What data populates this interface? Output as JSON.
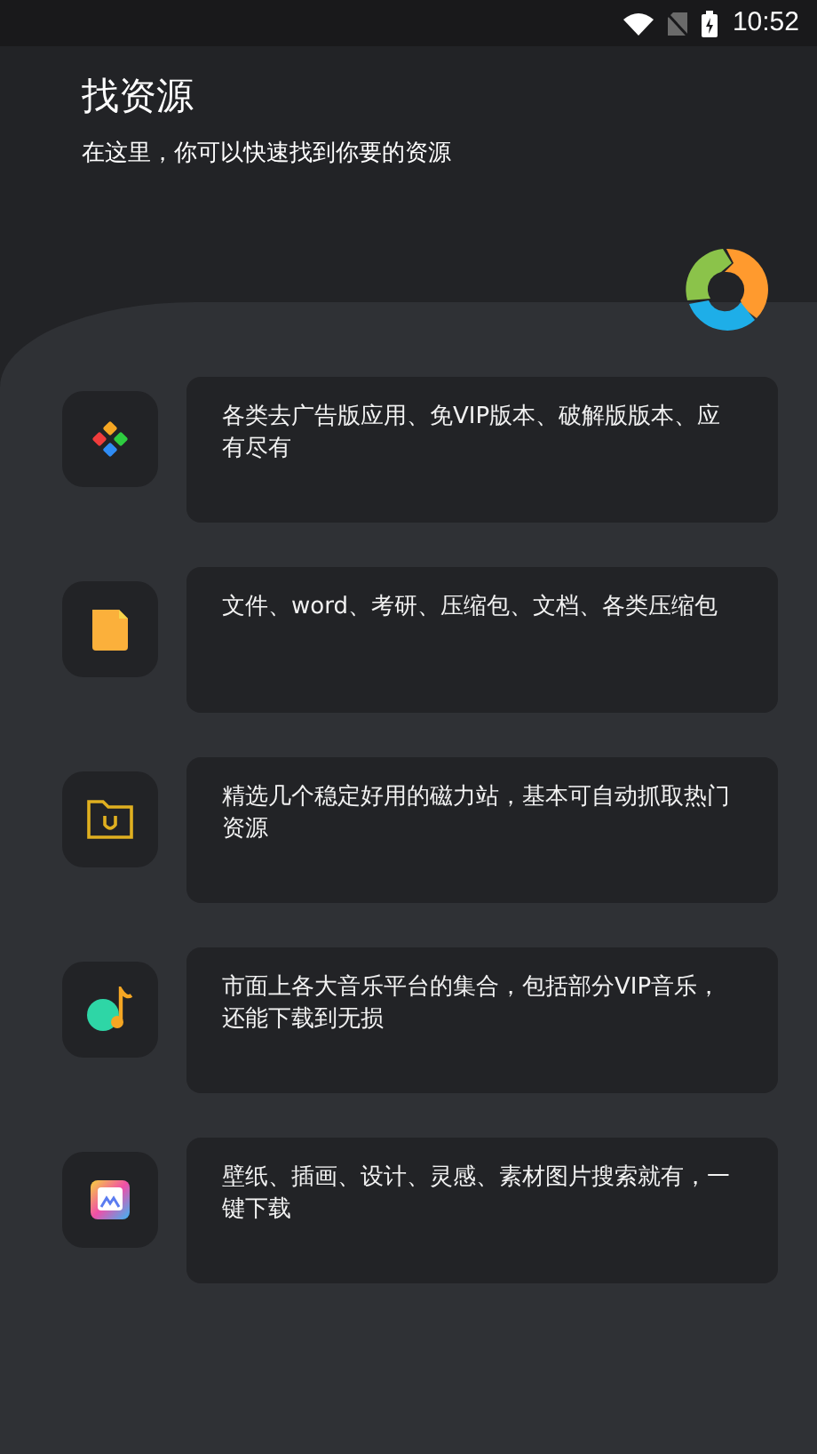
{
  "status_bar": {
    "time": "10:52"
  },
  "header": {
    "title": "找资源",
    "subtitle": "在这里，你可以快速找到你要的资源"
  },
  "items": [
    {
      "kind": "apps",
      "text": "各类去广告版应用、免VIP版本、破解版版本、应有尽有"
    },
    {
      "kind": "document",
      "text": "文件、word、考研、压缩包、文档、各类压缩包"
    },
    {
      "kind": "magnet",
      "text": "精选几个稳定好用的磁力站，基本可自动抓取热门资源"
    },
    {
      "kind": "music",
      "text": "市面上各大音乐平台的集合，包括部分VIP音乐，还能下载到无损"
    },
    {
      "kind": "image",
      "text": "壁纸、插画、设计、灵感、素材图片搜索就有，一键下载"
    }
  ]
}
